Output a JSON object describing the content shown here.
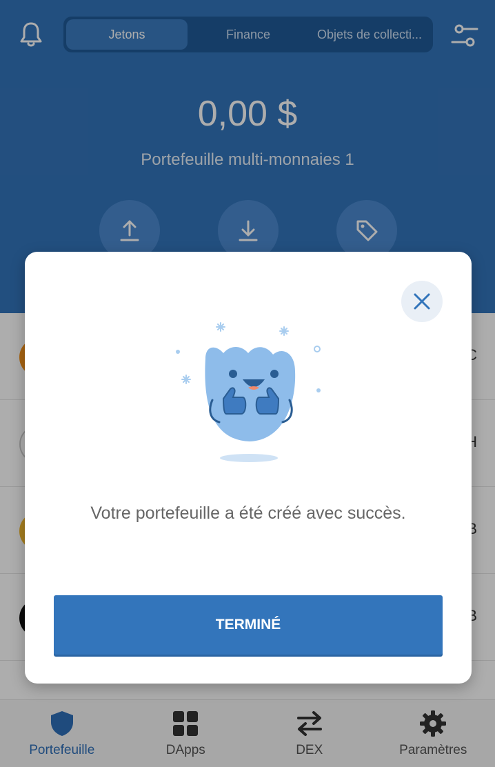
{
  "header": {
    "tabs": [
      {
        "label": "Jetons"
      },
      {
        "label": "Finance"
      },
      {
        "label": "Objets de collecti..."
      }
    ],
    "balance": "0,00 $",
    "wallet_name": "Portefeuille multi-monnaies 1",
    "actions": [
      {
        "icon": "send-icon"
      },
      {
        "icon": "receive-icon"
      },
      {
        "icon": "buy-tag-icon"
      }
    ]
  },
  "list": {
    "rows": [
      {
        "coin_color": "#f7931a",
        "suffix": "C"
      },
      {
        "coin_color": "#ffffff",
        "suffix": "H"
      },
      {
        "coin_color": "#f3ba2f",
        "suffix": "B"
      },
      {
        "coin_color": "#111111",
        "suffix": "B"
      }
    ]
  },
  "modal": {
    "message": "Votre portefeuille a été créé avec succès.",
    "done_label": "TERMINÉ",
    "close_icon": "close-icon"
  },
  "bottom_nav": {
    "items": [
      {
        "label": "Portefeuille",
        "icon": "shield-icon"
      },
      {
        "label": "DApps",
        "icon": "grid-icon"
      },
      {
        "label": "DEX",
        "icon": "swap-icon"
      },
      {
        "label": "Paramètres",
        "icon": "gear-icon"
      }
    ]
  },
  "colors": {
    "primary": "#3375bb",
    "tab_track": "#1f5a98",
    "active_nav": "#2f6fb8"
  }
}
